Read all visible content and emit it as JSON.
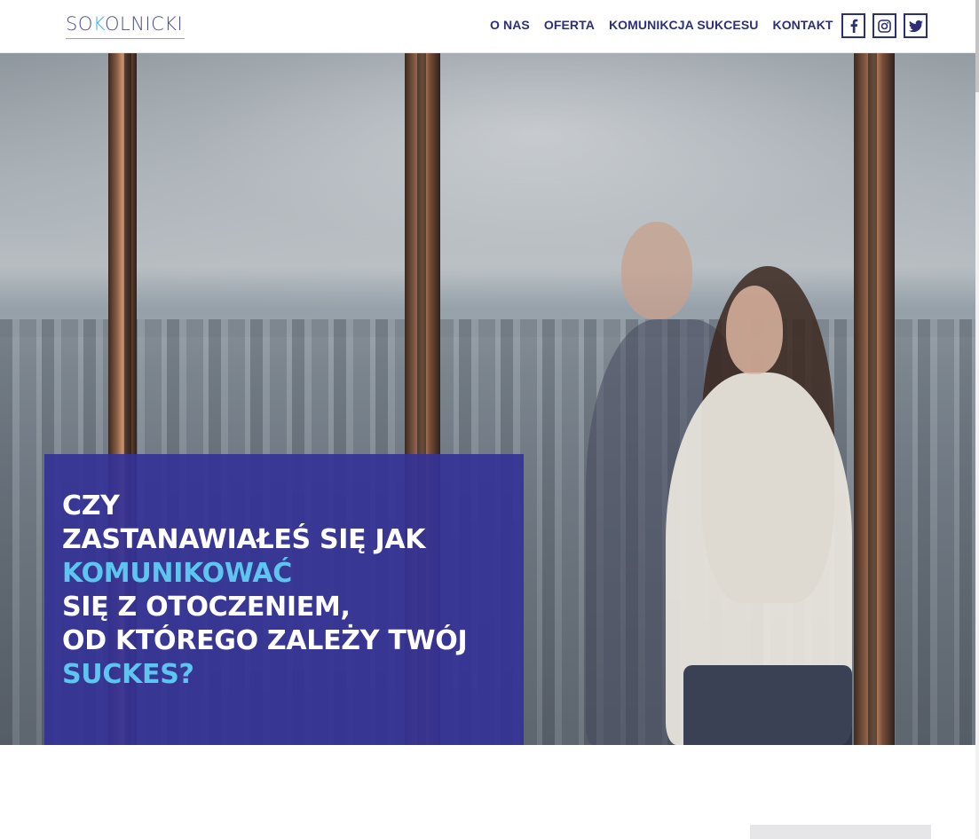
{
  "header": {
    "logo": {
      "part1": "SO",
      "accent": "K",
      "part2": "OLNICKI"
    },
    "nav": [
      {
        "label": "O NAS"
      },
      {
        "label": "OFERTA"
      },
      {
        "label": "KOMUNIKCJA SUKCESU"
      },
      {
        "label": "KONTAKT"
      }
    ],
    "social": [
      {
        "icon": "facebook-icon"
      },
      {
        "icon": "instagram-icon"
      },
      {
        "icon": "twitter-icon"
      }
    ]
  },
  "hero": {
    "lines": [
      {
        "text": "CZY",
        "highlight": false
      },
      {
        "text": "ZASTANAWIAŁEŚ SIĘ JAK",
        "highlight": false
      },
      {
        "text": "KOMUNIKOWAĆ",
        "highlight": true
      },
      {
        "text": "SIĘ Z OTOCZENIEM,",
        "highlight": false
      },
      {
        "text": "OD KTÓREGO ZALEŻY TWÓJ",
        "highlight": false
      },
      {
        "text": "SUCKES?",
        "highlight": true
      }
    ]
  },
  "colors": {
    "brand": "#2d2f78",
    "accent": "#3fb2ea",
    "overlay": "#34329a",
    "highlight": "#5ec4f0"
  }
}
